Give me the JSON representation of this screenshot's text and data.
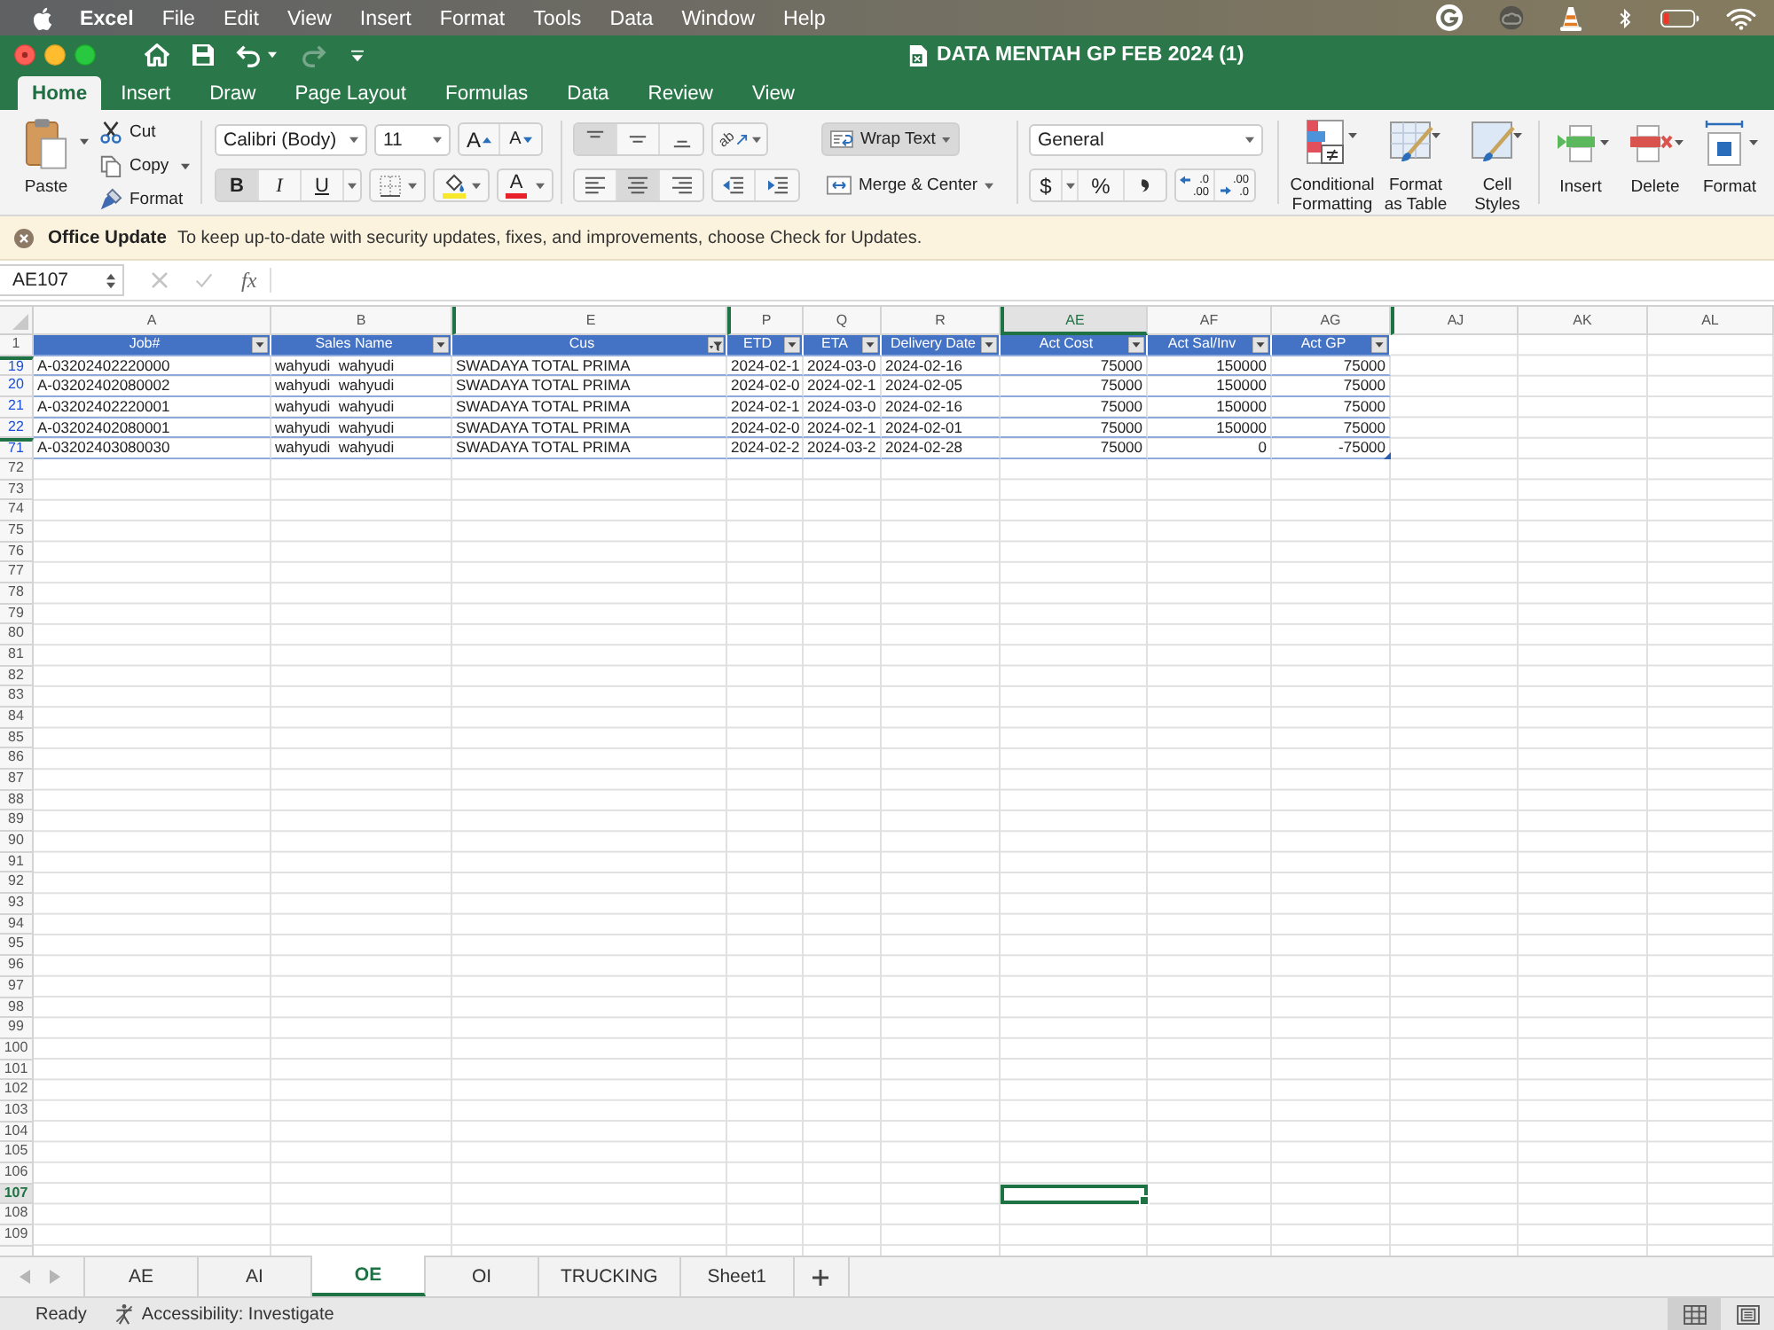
{
  "menu_bar": {
    "app": "Excel",
    "items": [
      "File",
      "Edit",
      "View",
      "Insert",
      "Format",
      "Tools",
      "Data",
      "Window",
      "Help"
    ]
  },
  "title_bar": {
    "title": "DATA MENTAH GP FEB 2024 (1)"
  },
  "ribbon_tabs": [
    {
      "label": "Home",
      "selected": true
    },
    {
      "label": "Insert",
      "selected": false
    },
    {
      "label": "Draw",
      "selected": false
    },
    {
      "label": "Page Layout",
      "selected": false
    },
    {
      "label": "Formulas",
      "selected": false
    },
    {
      "label": "Data",
      "selected": false
    },
    {
      "label": "Review",
      "selected": false
    },
    {
      "label": "View",
      "selected": false
    }
  ],
  "ribbon": {
    "clipboard": {
      "paste": "Paste",
      "cut": "Cut",
      "copy": "Copy",
      "format_painter": "Format"
    },
    "font": {
      "name": "Calibri (Body)",
      "size": "11",
      "grow_glyph": "A",
      "shrink_glyph": "A",
      "styles": [
        {
          "kind": "bold",
          "glyph": "B",
          "on": true
        },
        {
          "kind": "italic",
          "glyph": "I",
          "on": false
        },
        {
          "kind": "underline",
          "glyph": "U",
          "on": false
        }
      ],
      "font_color_glyph": "A"
    },
    "alignment": {
      "vertical": [
        {
          "kind": "top",
          "selected": true
        },
        {
          "kind": "middle",
          "selected": false
        },
        {
          "kind": "bottom",
          "selected": false
        }
      ],
      "orientation_glyph": "ab",
      "horizontal": [
        {
          "kind": "left",
          "selected": false
        },
        {
          "kind": "center",
          "selected": true
        },
        {
          "kind": "right",
          "selected": false
        }
      ],
      "wrap_text": {
        "label": "Wrap Text",
        "on": true
      },
      "merge": "Merge & Center"
    },
    "number": {
      "format": "General",
      "currency": "$",
      "percent": "%",
      "increase_decimal": [
        ".0",
        ".00"
      ],
      "decrease_decimal": [
        ".00",
        ".0"
      ]
    },
    "styles": [
      {
        "kind": "conditional",
        "lines": [
          "Conditional",
          "Formatting"
        ]
      },
      {
        "kind": "table",
        "lines": [
          "Format",
          "as Table"
        ]
      },
      {
        "kind": "cell",
        "lines": [
          "Cell",
          "Styles"
        ]
      }
    ],
    "cells": [
      {
        "kind": "insert",
        "label": "Insert"
      },
      {
        "kind": "delete",
        "label": "Delete"
      },
      {
        "kind": "format",
        "label": "Format"
      }
    ]
  },
  "update_bar": {
    "title": "Office Update",
    "message": "To keep up-to-date with security updates, fixes, and improvements, choose Check for Updates."
  },
  "formula_bar": {
    "name_box": "AE107",
    "fx": "fx"
  },
  "sheet": {
    "columns": [
      {
        "letter": "A",
        "title": "Job#",
        "kind": "text",
        "filtered": false,
        "selected": false,
        "hidden_before": false
      },
      {
        "letter": "B",
        "title": "Sales Name",
        "kind": "text",
        "filtered": false,
        "selected": false,
        "hidden_before": false
      },
      {
        "letter": "E",
        "title": "Cus",
        "kind": "text",
        "filtered": true,
        "selected": false,
        "hidden_before": true
      },
      {
        "letter": "P",
        "title": "ETD",
        "kind": "text",
        "filtered": false,
        "selected": false,
        "hidden_before": true
      },
      {
        "letter": "Q",
        "title": "ETA",
        "kind": "text",
        "filtered": false,
        "selected": false,
        "hidden_before": false
      },
      {
        "letter": "R",
        "title": "Delivery Date",
        "kind": "text",
        "filtered": false,
        "selected": false,
        "hidden_before": false
      },
      {
        "letter": "AE",
        "title": "Act Cost",
        "kind": "number",
        "filtered": false,
        "selected": true,
        "hidden_before": true
      },
      {
        "letter": "AF",
        "title": "Act Sal/Inv",
        "kind": "number",
        "filtered": false,
        "selected": false,
        "hidden_before": false
      },
      {
        "letter": "AG",
        "title": "Act GP",
        "kind": "number",
        "filtered": false,
        "selected": false,
        "hidden_before": false
      },
      {
        "letter": "AJ",
        "selected": false,
        "hidden_before": true
      },
      {
        "letter": "AK",
        "selected": false,
        "hidden_before": false
      },
      {
        "letter": "AL",
        "selected": false,
        "hidden_before": false
      }
    ],
    "header_row": {
      "number": "1",
      "selected": false
    },
    "rows": [
      {
        "number": "19",
        "selected": false,
        "hidden_before": true,
        "cells": [
          "A-03202402220000",
          "wahyudi  wahyudi",
          "SWADAYA TOTAL PRIMA",
          "2024-02-1",
          "2024-03-0",
          "2024-02-16",
          "75000",
          "150000",
          "75000"
        ]
      },
      {
        "number": "20",
        "selected": false,
        "hidden_before": false,
        "cells": [
          "A-03202402080002",
          "wahyudi  wahyudi",
          "SWADAYA TOTAL PRIMA",
          "2024-02-0",
          "2024-02-1",
          "2024-02-05",
          "75000",
          "150000",
          "75000"
        ]
      },
      {
        "number": "21",
        "selected": false,
        "hidden_before": false,
        "cells": [
          "A-03202402220001",
          "wahyudi  wahyudi",
          "SWADAYA TOTAL PRIMA",
          "2024-02-1",
          "2024-03-0",
          "2024-02-16",
          "75000",
          "150000",
          "75000"
        ]
      },
      {
        "number": "22",
        "selected": false,
        "hidden_before": false,
        "cells": [
          "A-03202402080001",
          "wahyudi  wahyudi",
          "SWADAYA TOTAL PRIMA",
          "2024-02-0",
          "2024-02-1",
          "2024-02-01",
          "75000",
          "150000",
          "75000"
        ]
      },
      {
        "number": "71",
        "selected": false,
        "hidden_before": true,
        "cells": [
          "A-03202403080030",
          "wahyudi  wahyudi",
          "SWADAYA TOTAL PRIMA",
          "2024-02-2",
          "2024-03-2",
          "2024-02-28",
          "75000",
          "0",
          "-75000"
        ]
      }
    ],
    "empty_rows": [
      {
        "number": "72",
        "selected": false
      },
      {
        "number": "73",
        "selected": false
      },
      {
        "number": "74",
        "selected": false
      },
      {
        "number": "75",
        "selected": false
      },
      {
        "number": "76",
        "selected": false
      },
      {
        "number": "77",
        "selected": false
      },
      {
        "number": "78",
        "selected": false
      },
      {
        "number": "79",
        "selected": false
      },
      {
        "number": "80",
        "selected": false
      },
      {
        "number": "81",
        "selected": false
      },
      {
        "number": "82",
        "selected": false
      },
      {
        "number": "83",
        "selected": false
      },
      {
        "number": "84",
        "selected": false
      },
      {
        "number": "85",
        "selected": false
      },
      {
        "number": "86",
        "selected": false
      },
      {
        "number": "87",
        "selected": false
      },
      {
        "number": "88",
        "selected": false
      },
      {
        "number": "89",
        "selected": false
      },
      {
        "number": "90",
        "selected": false
      },
      {
        "number": "91",
        "selected": false
      },
      {
        "number": "92",
        "selected": false
      },
      {
        "number": "93",
        "selected": false
      },
      {
        "number": "94",
        "selected": false
      },
      {
        "number": "95",
        "selected": false
      },
      {
        "number": "96",
        "selected": false
      },
      {
        "number": "97",
        "selected": false
      },
      {
        "number": "98",
        "selected": false
      },
      {
        "number": "99",
        "selected": false
      },
      {
        "number": "100",
        "selected": false
      },
      {
        "number": "101",
        "selected": false
      },
      {
        "number": "102",
        "selected": false
      },
      {
        "number": "103",
        "selected": false
      },
      {
        "number": "104",
        "selected": false
      },
      {
        "number": "105",
        "selected": false
      },
      {
        "number": "106",
        "selected": false
      },
      {
        "number": "107",
        "selected": true
      },
      {
        "number": "108",
        "selected": false
      },
      {
        "number": "109",
        "selected": false
      }
    ]
  },
  "sheet_tabs": [
    {
      "label": "AE",
      "selected": false
    },
    {
      "label": "AI",
      "selected": false
    },
    {
      "label": "OE",
      "selected": true
    },
    {
      "label": "OI",
      "selected": false
    },
    {
      "label": "TRUCKING",
      "selected": false
    },
    {
      "label": "Sheet1",
      "selected": false
    }
  ],
  "status_bar": {
    "ready": "Ready",
    "accessibility": "Accessibility: Investigate",
    "views": [
      {
        "kind": "normal",
        "selected": true
      },
      {
        "kind": "page_layout",
        "selected": false
      }
    ]
  }
}
